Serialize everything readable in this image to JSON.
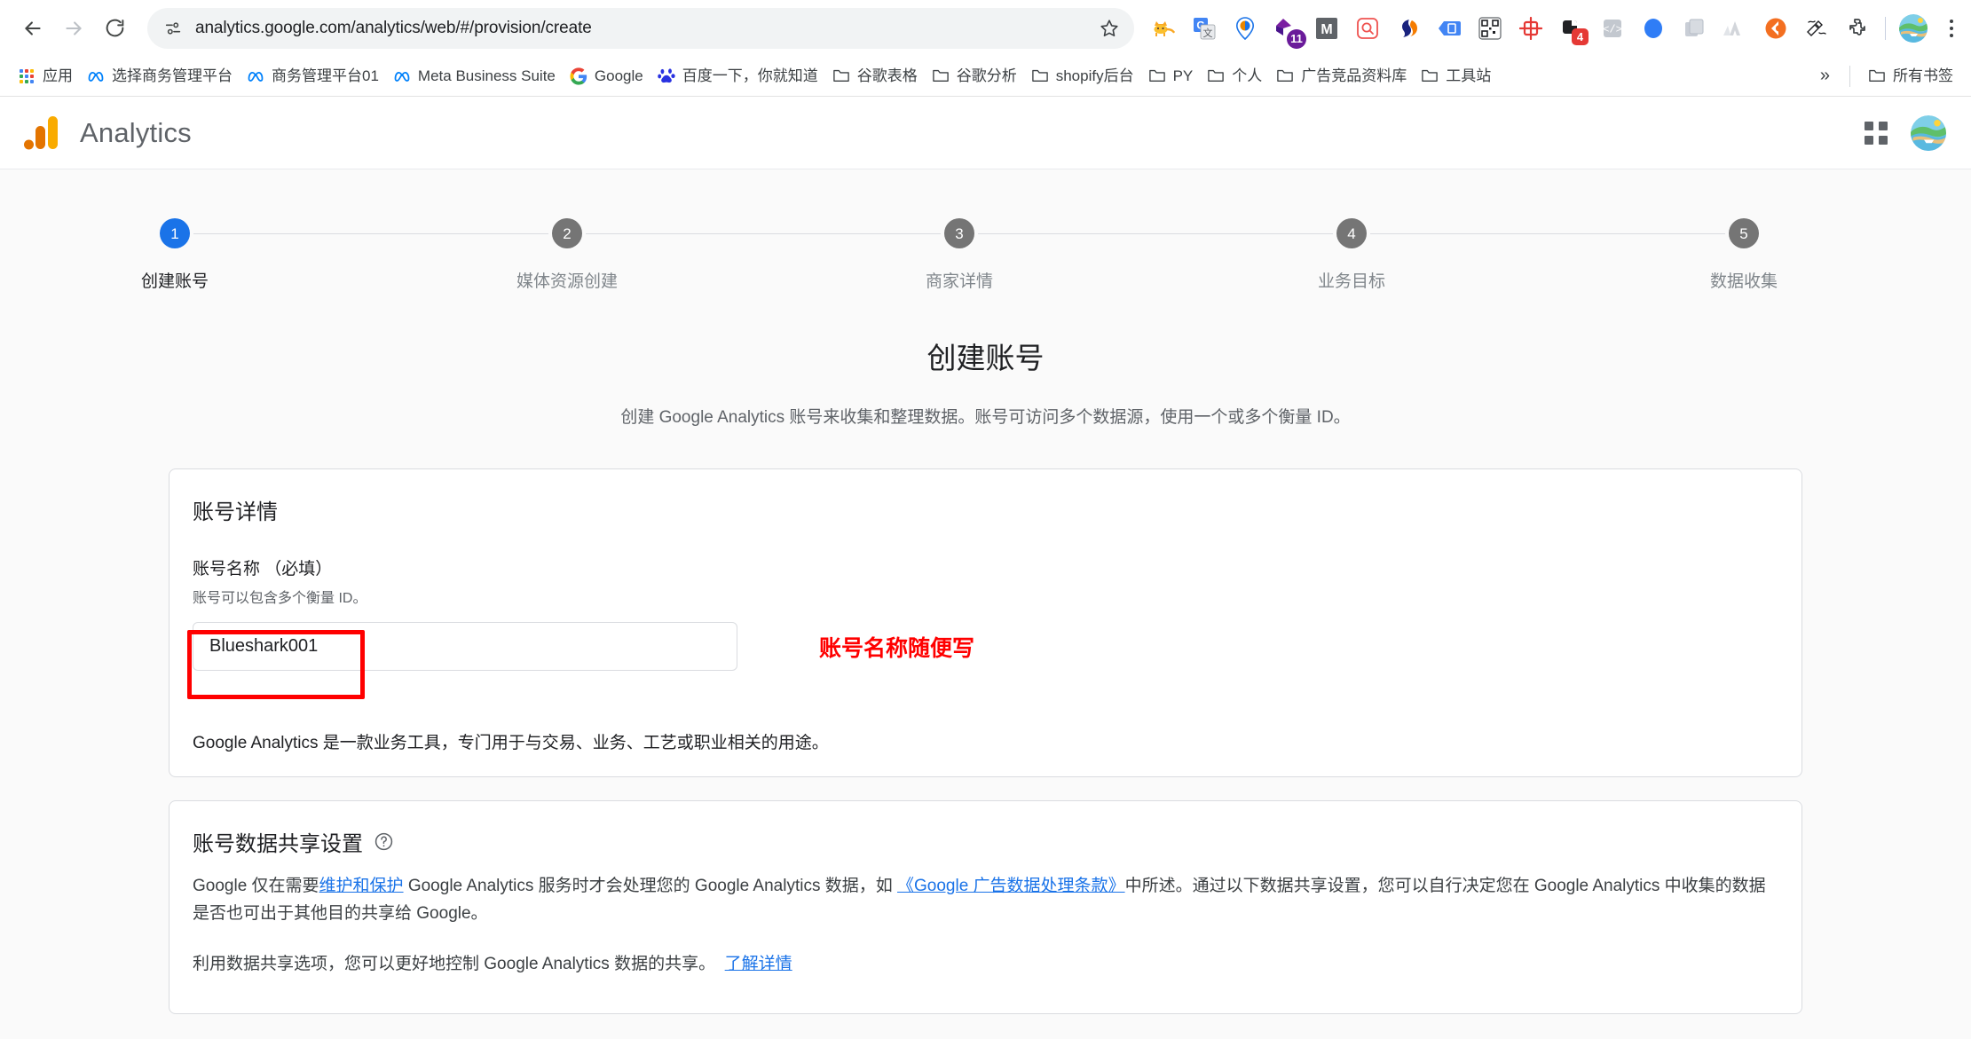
{
  "browser": {
    "nav": {
      "back_icon": "back-arrow-icon",
      "forward_icon": "forward-arrow-icon",
      "reload_icon": "reload-icon"
    },
    "omnibox": {
      "url": "analytics.google.com/analytics/web/#/provision/create",
      "site_info_icon": "site-settings-icon",
      "bookmark_star_icon": "star-icon"
    },
    "extensions": [
      {
        "name": "cat-extension-icon",
        "badge": ""
      },
      {
        "name": "google-translate-icon",
        "badge": ""
      },
      {
        "name": "location-pin-icon",
        "badge": ""
      },
      {
        "name": "notion-extension-icon",
        "badge": "11"
      },
      {
        "name": "mailtrack-icon",
        "badge": ""
      },
      {
        "name": "search-box-extension-icon",
        "badge": ""
      },
      {
        "name": "similarweb-icon",
        "badge": ""
      },
      {
        "name": "tag-assistant-icon",
        "badge": ""
      },
      {
        "name": "qr-code-icon",
        "badge": ""
      },
      {
        "name": "crosshair-target-icon",
        "badge": ""
      },
      {
        "name": "clipboard-extension-icon",
        "badge": "4"
      },
      {
        "name": "code-snippet-icon",
        "badge": ""
      },
      {
        "name": "blue-circle-extension-icon",
        "badge": ""
      },
      {
        "name": "copy-pages-icon",
        "badge": ""
      },
      {
        "name": "mountain-extension-icon",
        "badge": ""
      },
      {
        "name": "orange-arrow-extension-icon",
        "badge": ""
      },
      {
        "name": "scribble-pen-icon",
        "badge": ""
      },
      {
        "name": "puzzle-piece-icon",
        "badge": ""
      }
    ],
    "profile_avatar": "user-avatar",
    "menu_icon": "three-dot-menu-icon"
  },
  "bookmarks": {
    "apps_label": "应用",
    "items": [
      {
        "label": "选择商务管理平台",
        "icon": "meta-icon"
      },
      {
        "label": "商务管理平台01",
        "icon": "meta-icon"
      },
      {
        "label": "Meta Business Suite",
        "icon": "meta-icon"
      },
      {
        "label": "Google",
        "icon": "google-icon"
      },
      {
        "label": "百度一下，你就知道",
        "icon": "baidu-icon"
      },
      {
        "label": "谷歌表格",
        "icon": "folder-icon"
      },
      {
        "label": "谷歌分析",
        "icon": "folder-icon"
      },
      {
        "label": "shopify后台",
        "icon": "folder-icon"
      },
      {
        "label": "PY",
        "icon": "folder-icon"
      },
      {
        "label": "个人",
        "icon": "folder-icon"
      },
      {
        "label": "广告竞品资料库",
        "icon": "folder-icon"
      },
      {
        "label": "工具站",
        "icon": "folder-icon"
      }
    ],
    "overflow_label": "»",
    "all_bookmarks_label": "所有书签"
  },
  "app_header": {
    "title": "Analytics",
    "logo_icon": "google-analytics-logo",
    "apps_grid_icon": "google-apps-grid-icon",
    "avatar_icon": "account-avatar"
  },
  "stepper": {
    "steps": [
      {
        "number": "1",
        "label": "创建账号",
        "active": true
      },
      {
        "number": "2",
        "label": "媒体资源创建",
        "active": false
      },
      {
        "number": "3",
        "label": "商家详情",
        "active": false
      },
      {
        "number": "4",
        "label": "业务目标",
        "active": false
      },
      {
        "number": "5",
        "label": "数据收集",
        "active": false
      }
    ]
  },
  "main": {
    "title": "创建账号",
    "subtitle": "创建 Google Analytics 账号来收集和整理数据。账号可访问多个数据源，使用一个或多个衡量 ID。",
    "account_details": {
      "card_title": "账号详情",
      "field_label": "账号名称 （必填）",
      "field_hint": "账号可以包含多个衡量 ID。",
      "input_value": "Blueshark001",
      "input_placeholder": "",
      "annotation_text": "账号名称随便写",
      "annotation_color": "#ff0000",
      "note": "Google Analytics 是一款业务工具，专门用于与交易、业务、工艺或职业相关的用途。"
    },
    "data_sharing": {
      "card_title": "账号数据共享设置",
      "help_icon": "help-circle-icon",
      "paragraph1_part1": "Google 仅在需要",
      "paragraph1_link1": "维护和保护",
      "paragraph1_part2": " Google Analytics 服务时才会处理您的 Google Analytics 数据，如 ",
      "paragraph1_link2": "《Google 广告数据处理条款》",
      "paragraph1_part3": "中所述。通过以下数据共享设置，您可以自行决定您在 Google Analytics 中收集的数据是否也可出于其他目的共享给 Google。",
      "paragraph2_text": "利用数据共享选项，您可以更好地控制 Google Analytics 数据的共享。",
      "paragraph2_link": "了解详情"
    }
  },
  "colors": {
    "accent_blue": "#1a73e8",
    "step_inactive": "#757575",
    "annotation_red": "#ff0000",
    "ga_orange": "#f9ab00",
    "ga_orange_dark": "#e37400"
  }
}
